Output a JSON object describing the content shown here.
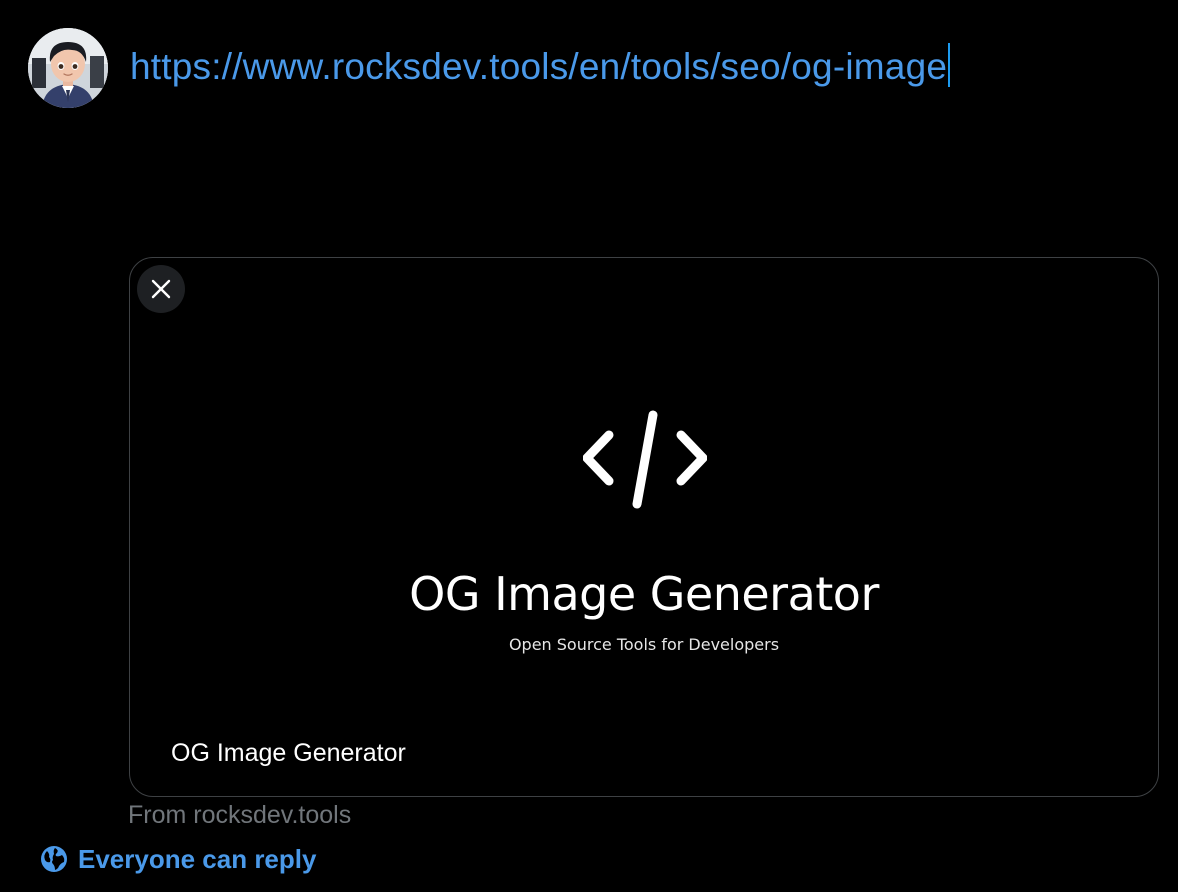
{
  "composer": {
    "text": "https://www.rocksdev.tools/en/tools/seo/og-image"
  },
  "link_card": {
    "og_image": {
      "icon": "code-brackets-icon",
      "title": "OG Image Generator",
      "subtitle": "Open Source Tools for Developers"
    },
    "label": "OG Image Generator",
    "close_icon": "close-icon"
  },
  "from_domain": "From rocksdev.tools",
  "reply_setting": {
    "icon": "globe-icon",
    "label": "Everyone can reply"
  },
  "colors": {
    "accent": "#1d9bf0",
    "background": "#000000",
    "muted": "#71767b",
    "border": "#3e4144"
  }
}
